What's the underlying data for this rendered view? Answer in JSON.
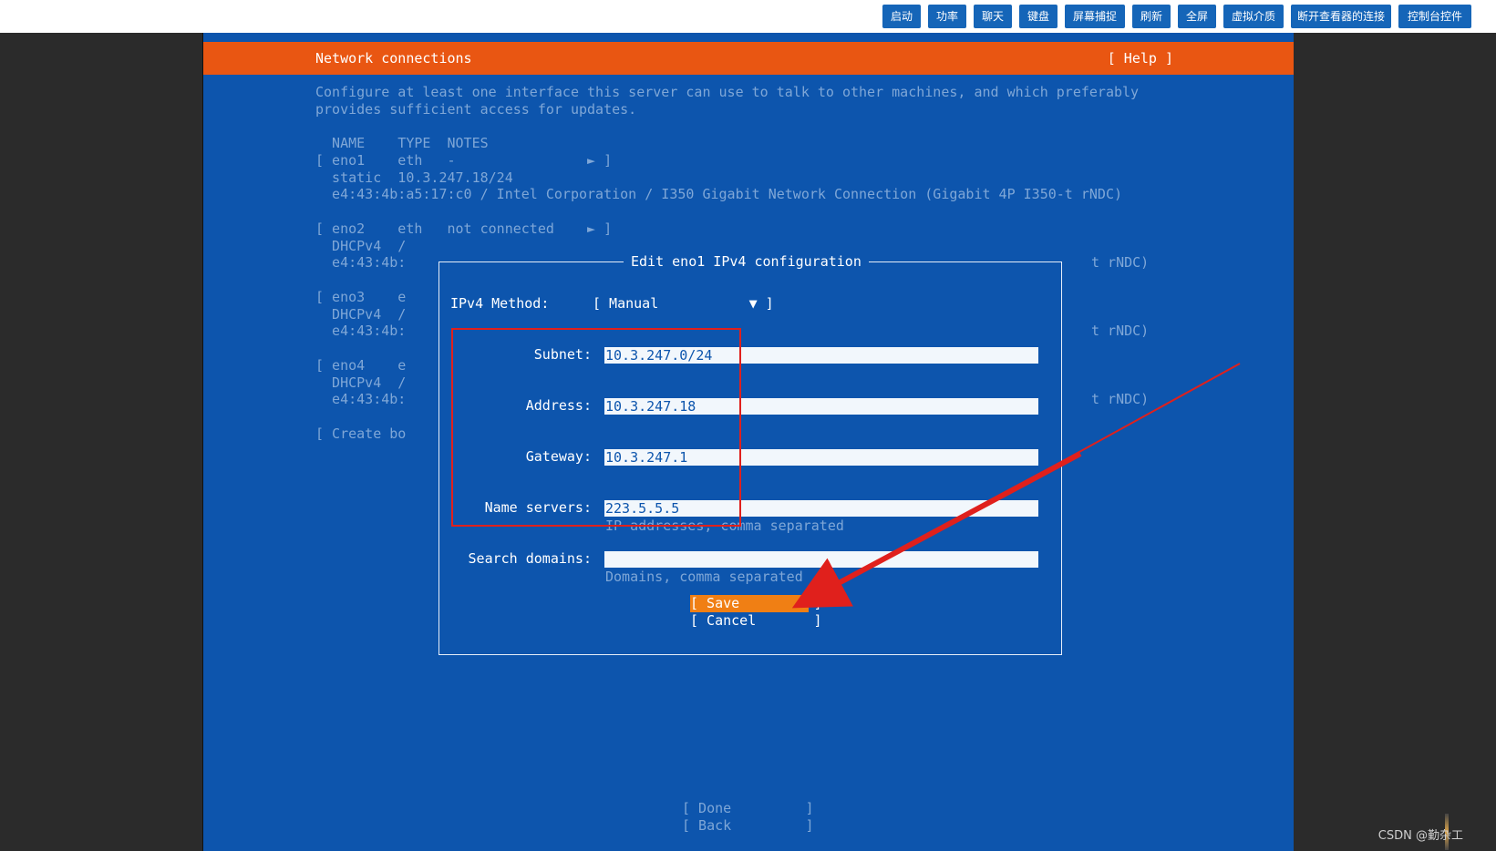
{
  "toolbar": {
    "buttons": [
      "启动",
      "功率",
      "聊天",
      "键盘",
      "屏幕捕捉",
      "刷新",
      "全屏",
      "虚拟介质",
      "断开查看器的连接",
      "控制台控件"
    ],
    "accent": "#1565b8"
  },
  "header": {
    "title": "Network connections",
    "help": "[ Help ]",
    "color": "#e95612"
  },
  "intro": {
    "line1": "Configure at least one interface this server can use to talk to other machines, and which preferably",
    "line2": "provides sufficient access for updates."
  },
  "table": {
    "header": "  NAME    TYPE  NOTES",
    "eno1_row": "[ eno1    eth   -                ► ]",
    "eno1_static": "  static  10.3.247.18/24",
    "eno1_mac": "  e4:43:4b:a5:17:c0 / Intel Corporation / I350 Gigabit Network Connection (Gigabit 4P I350-t rNDC)",
    "eno2_row": "[ eno2    eth   not connected    ► ]",
    "eno2_dhcp": "  DHCPv4  /",
    "eno2_mac": "  e4:43:4b:",
    "eno2_tail": "t rNDC)",
    "eno3_row": "[ eno3    e",
    "eno3_dhcp": "  DHCPv4  /",
    "eno3_mac": "  e4:43:4b:",
    "eno3_tail": "t rNDC)",
    "eno4_row": "[ eno4    e",
    "eno4_dhcp": "  DHCPv4  /",
    "eno4_mac": "  e4:43:4b:",
    "eno4_tail": "t rNDC)",
    "create_bond": "[ Create bo"
  },
  "dialog": {
    "title": "Edit eno1 IPv4 configuration",
    "method_label": "IPv4 Method:",
    "method_value": "[ Manual           ▼ ]",
    "subnet_label": "Subnet:",
    "subnet_value": "10.3.247.0/24",
    "address_label": "Address:",
    "address_value": "10.3.247.18",
    "gateway_label": "Gateway:",
    "gateway_value": "10.3.247.1",
    "nameservers_label": "Name servers:",
    "nameservers_value": "223.5.5.5",
    "nameservers_hint": "IP addresses, comma separated",
    "searchdomains_label": "Search domains:",
    "searchdomains_value": "",
    "searchdomains_hint": "Domains, comma separated",
    "save_label": "[ Save         ]",
    "cancel_label": "[ Cancel       ]"
  },
  "footer": {
    "done_label": "[ Done         ]",
    "back_label": "[ Back         ]"
  },
  "watermark": "CSDN @勤杂工",
  "colors": {
    "console_bg": "#0d55ad",
    "annotation": "#e0201c",
    "save_highlight": "#f07f14"
  }
}
